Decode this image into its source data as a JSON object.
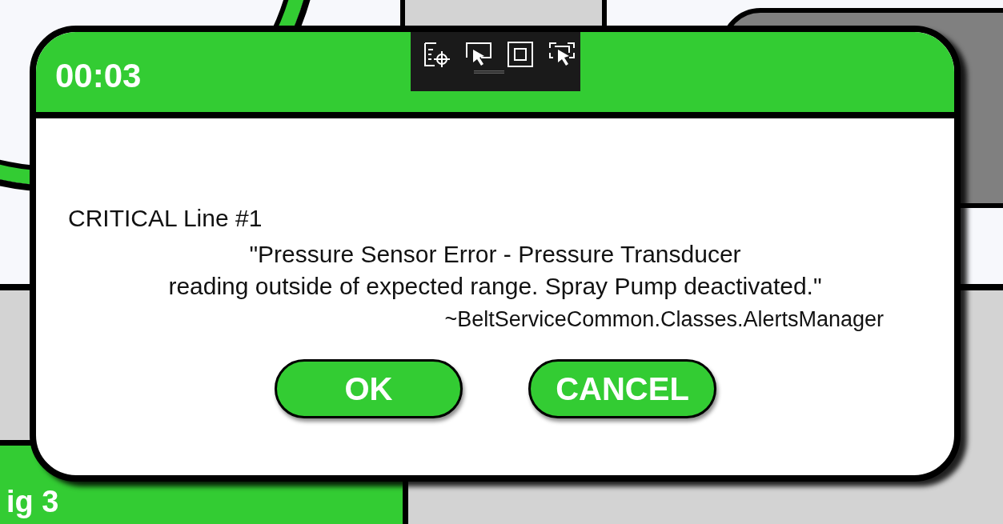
{
  "background": {
    "label": "ig 3"
  },
  "dialog": {
    "timer": "00:03",
    "heading": "CRITICAL Line #1",
    "message": "\"Pressure Sensor Error - Pressure Transducer\nreading outside of expected range. Spray Pump deactivated.\"",
    "source": "~BeltServiceCommon.Classes.AlertsManager",
    "buttons": [
      {
        "label": "OK"
      },
      {
        "label": "CANCEL"
      }
    ]
  }
}
